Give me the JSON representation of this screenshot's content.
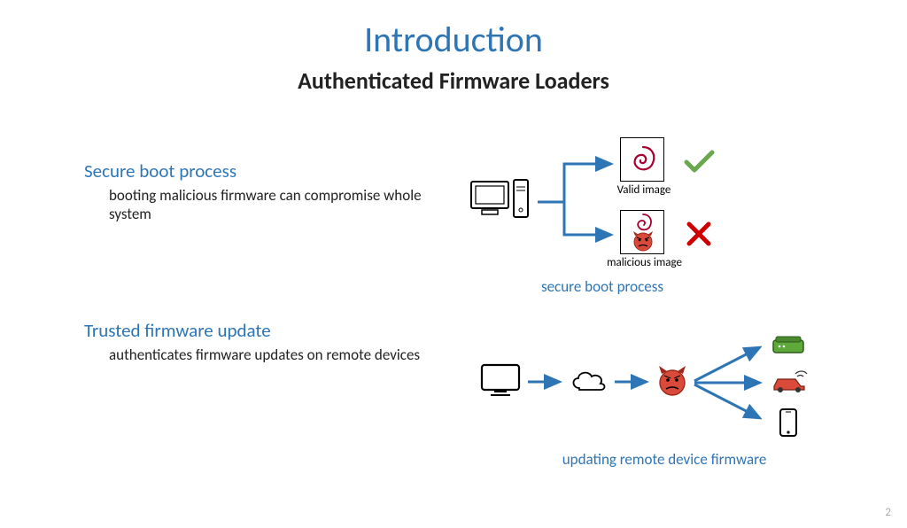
{
  "title": "Introduction",
  "subtitle": "Authenticated Firmware Loaders",
  "sections": [
    {
      "head": "Secure boot process",
      "body": "booting malicious firmware can compromise whole system"
    },
    {
      "head": "Trusted firmware update",
      "body": "authenticates firmware updates on remote devices"
    }
  ],
  "diagram1": {
    "valid_label": "Valid image",
    "malicious_label": "malicious image",
    "caption": "secure boot process"
  },
  "diagram2": {
    "caption": "updating remote device firmware"
  },
  "page_number": "2"
}
